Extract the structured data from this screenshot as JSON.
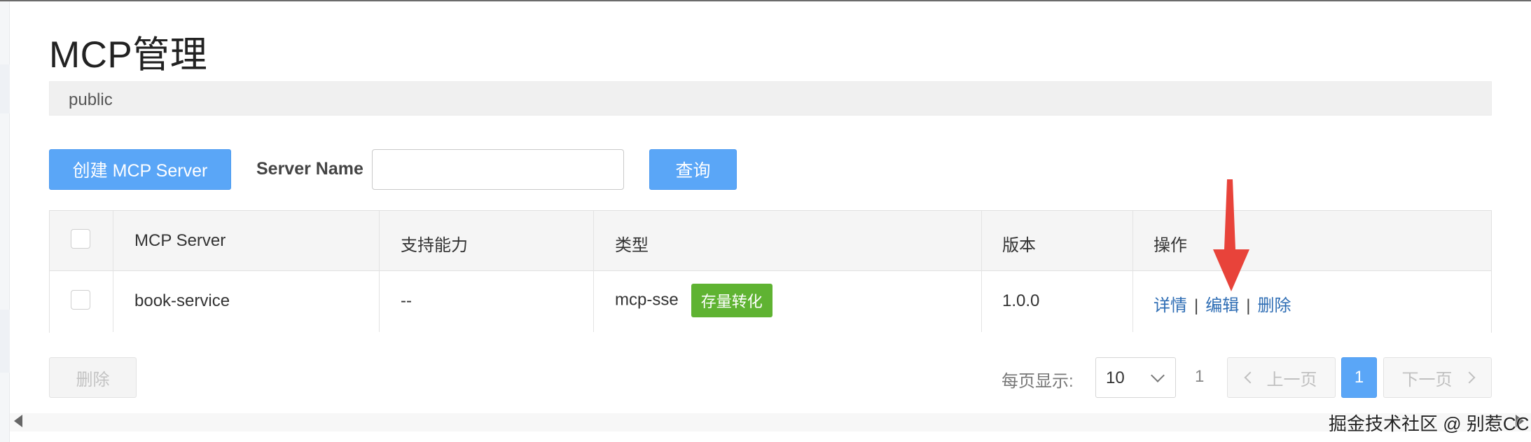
{
  "page": {
    "title": "MCP管理",
    "namespace": "public"
  },
  "toolbar": {
    "create_label": "创建 MCP Server",
    "server_name_label": "Server Name",
    "server_name_value": "",
    "server_name_placeholder": "",
    "query_label": "查询"
  },
  "table": {
    "headers": {
      "mcp_server": "MCP Server",
      "capability": "支持能力",
      "type": "类型",
      "version": "版本",
      "actions": "操作"
    },
    "rows": [
      {
        "name": "book-service",
        "capability": "--",
        "type": "mcp-sse",
        "type_tag": "存量转化",
        "version": "1.0.0",
        "actions": {
          "detail": "详情",
          "separator": "|",
          "edit": "编辑",
          "delete": "删除"
        }
      }
    ]
  },
  "footer": {
    "delete_label": "删除",
    "per_page_label": "每页显示:",
    "per_page_value": "10",
    "total_pages": "1",
    "prev_label": "上一页",
    "current_page": "1",
    "next_label": "下一页"
  },
  "watermark": "掘金技术社区 @ 别惹CC",
  "colors": {
    "primary": "#5aa6f7",
    "tag_green": "#5fb332",
    "link": "#2e6db4",
    "annotation": "#e8433a"
  },
  "icons": {
    "annotation": "red-arrow-down-icon",
    "select": "chevron-down-icon",
    "prev": "chevron-left-icon",
    "next": "chevron-right-icon"
  }
}
